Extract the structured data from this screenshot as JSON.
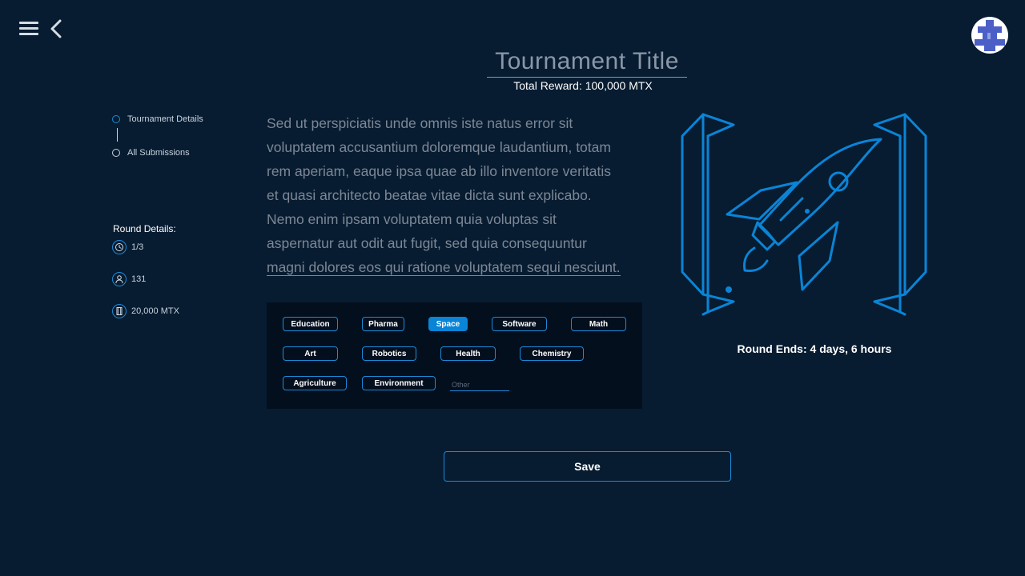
{
  "header": {
    "title": "Tournament Title",
    "total_reward": "Total Reward: 100,000 MTX",
    "menu_icon": "hamburger-menu-icon",
    "back_icon": "chevron-left-icon",
    "avatar_icon": "avatar-pattern-icon"
  },
  "steps": [
    {
      "label": "Tournament Details",
      "active": true
    },
    {
      "label": "All Submissions",
      "active": false
    }
  ],
  "round_details": {
    "label": "Round Details:",
    "round": "1/3",
    "participants": "131",
    "reward": "20,000 MTX"
  },
  "description": {
    "lines": [
      "Sed ut perspiciatis unde omnis iste natus error sit",
      "voluptatem accusantium doloremque laudantium, totam",
      "rem aperiam, eaque ipsa quae ab illo inventore veritatis",
      "et quasi architecto beatae vitae dicta sunt explicabo.",
      "Nemo enim ipsam voluptatem quia voluptas sit",
      "aspernatur aut odit aut fugit, sed quia consequuntur",
      "magni dolores eos qui ratione voluptatem sequi nesciunt."
    ]
  },
  "tags": {
    "items": [
      "Education",
      "Pharma",
      "Space",
      "Software",
      "Math",
      "Art",
      "Robotics",
      "Health",
      "Chemistry",
      "Agriculture",
      "Environment"
    ],
    "selected": "Space",
    "other_placeholder": "Other"
  },
  "illustration": {
    "icon": "rocket-icon"
  },
  "round_ends": "Round Ends: 4 days, 6 hours",
  "save_label": "Save",
  "colors": {
    "background": "#071c31",
    "panel": "#040f1e",
    "accent": "#0a84d6",
    "muted_text": "#7d8795"
  }
}
